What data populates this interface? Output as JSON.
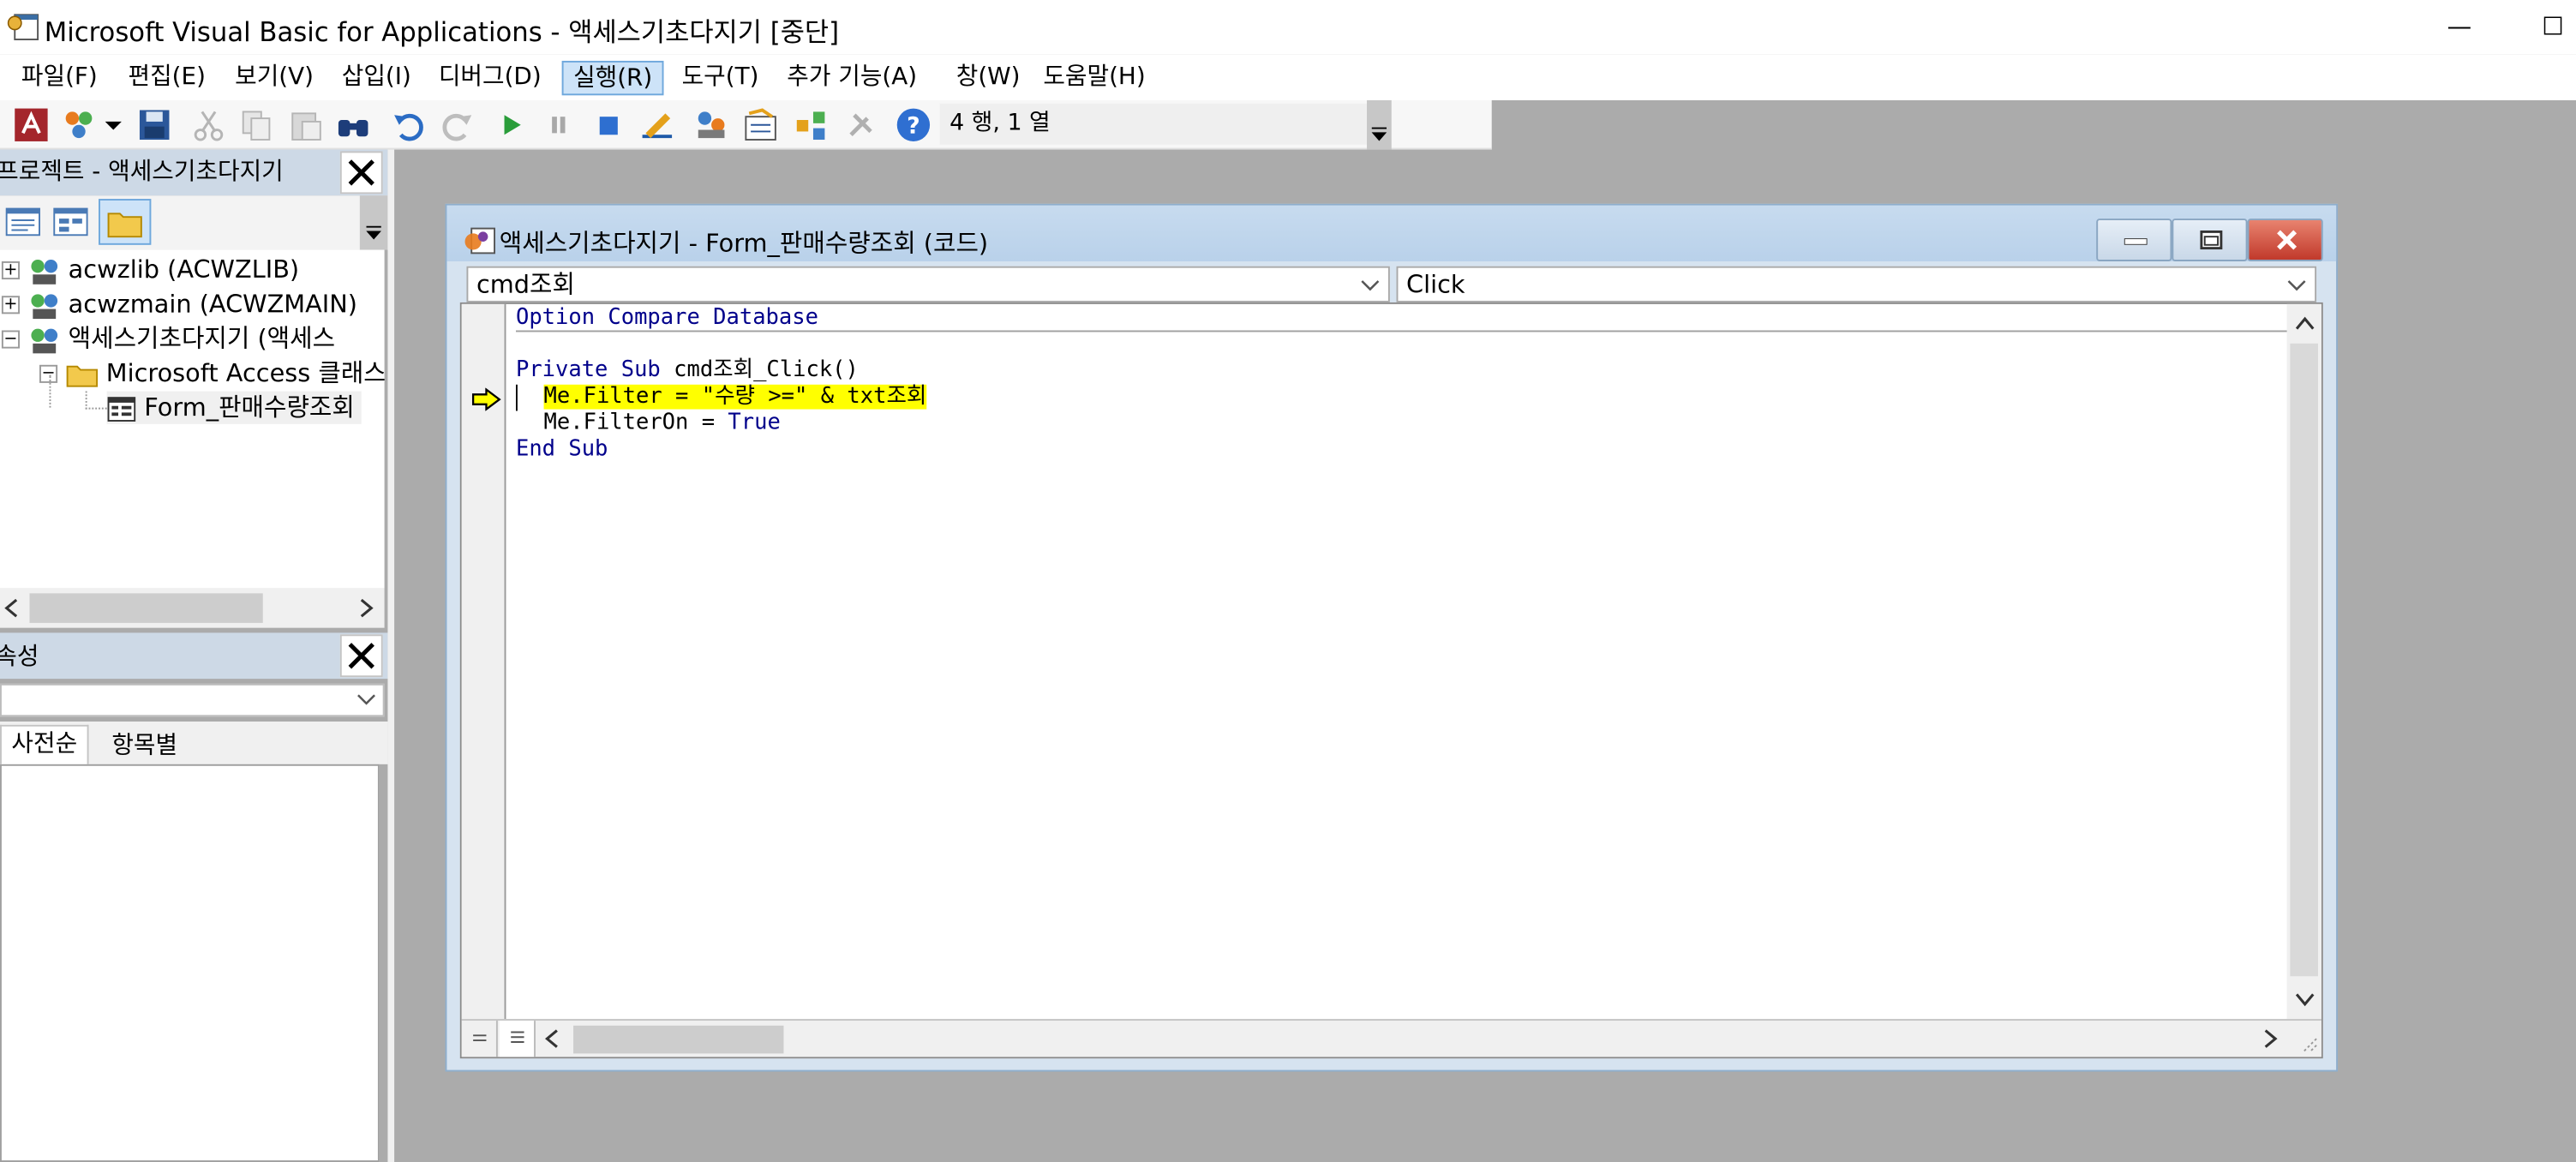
{
  "window": {
    "title": "Microsoft Visual Basic for Applications - 액세스기초다지기 [중단]",
    "min_symbol": "—",
    "max_symbol": "☐"
  },
  "menu": [
    "파일(F)",
    "편집(E)",
    "보기(V)",
    "삽입(I)",
    "디버그(D)",
    "실행(R)",
    "도구(T)",
    "추가 기능(A)",
    "창(W)",
    "도움말(H)"
  ],
  "menu_active_index": 5,
  "toolbar": {
    "position_status": "4 행, 1 열"
  },
  "project_pane": {
    "title": "프로젝트 - 액세스기초다지기",
    "tree": [
      {
        "expander": "+",
        "label": "acwzlib (ACWZLIB)"
      },
      {
        "expander": "+",
        "label": "acwzmain (ACWZMAIN)"
      },
      {
        "expander": "−",
        "label": "액세스기초다지기 (액세스"
      },
      {
        "expander": "−",
        "label": "Microsoft Access 클래스"
      },
      {
        "expander": "",
        "label": "Form_판매수량조회"
      }
    ]
  },
  "properties_pane": {
    "title": "속성",
    "tabs": [
      "사전순",
      "항목별"
    ]
  },
  "code_window": {
    "title": "액세스기초다지기 - Form_판매수량조회 (코드)",
    "object_combo": "cmd조회",
    "procedure_combo": "Click",
    "lines": {
      "l0": "Option Compare Database",
      "l1_kw": "Private Sub",
      "l1_rest": " cmd조회_Click()",
      "l2": "Me.Filter = \"수량 >=\" & txt조회",
      "l3_a": "Me.FilterOn = ",
      "l3_kw": "True",
      "l4": "End Sub"
    }
  },
  "colors": {
    "keyword": "#00008b",
    "highlight": "#ffff00",
    "execution_arrow": "#ffff00"
  }
}
